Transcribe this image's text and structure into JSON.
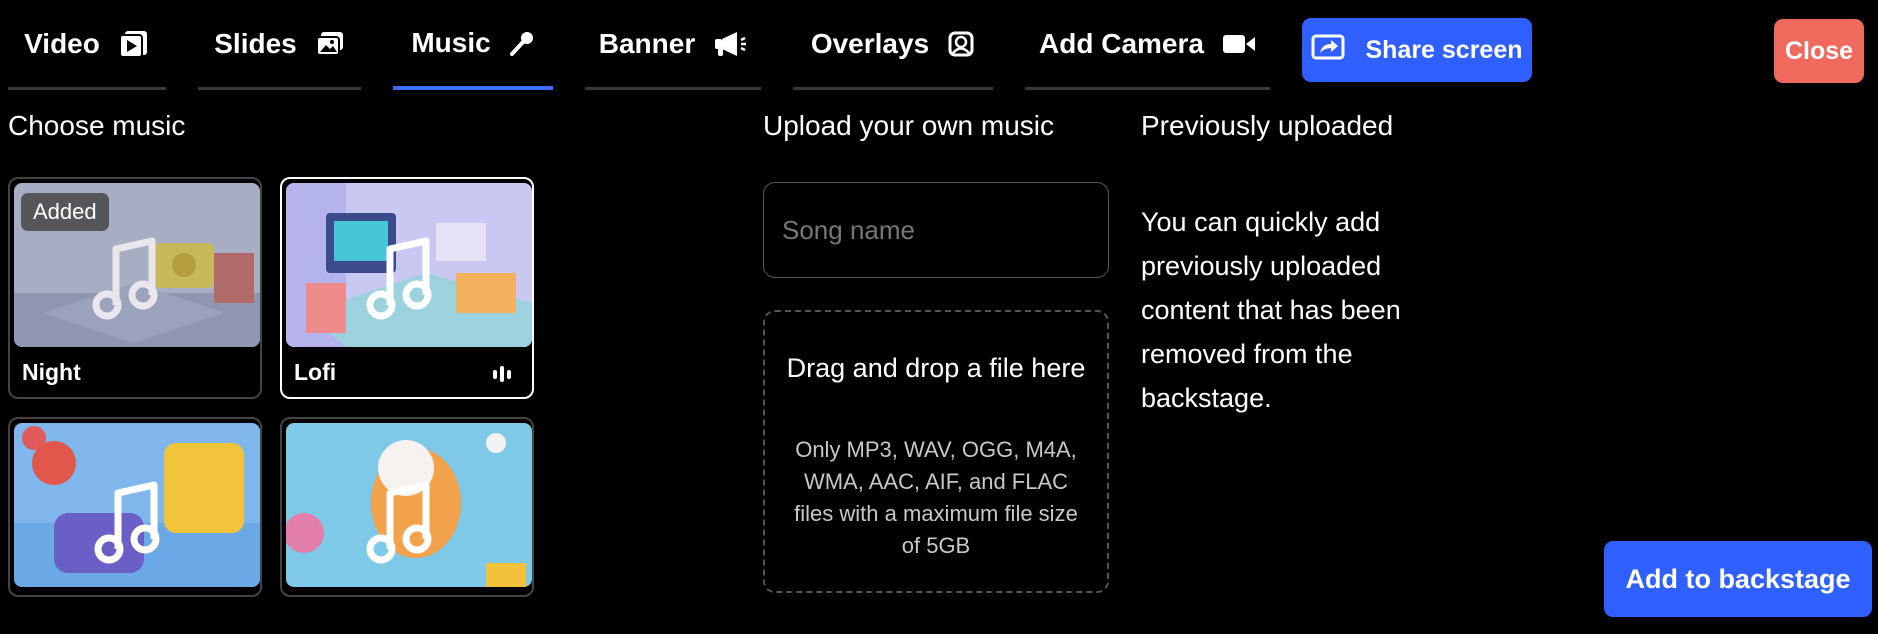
{
  "tabs": [
    {
      "label": "Video",
      "icon": "video-file-icon",
      "active": false
    },
    {
      "label": "Slides",
      "icon": "slides-icon",
      "active": false
    },
    {
      "label": "Music",
      "icon": "microphone-icon",
      "active": true
    },
    {
      "label": "Banner",
      "icon": "megaphone-icon",
      "active": false
    },
    {
      "label": "Overlays",
      "icon": "overlay-image-icon",
      "active": false
    },
    {
      "label": "Add Camera",
      "icon": "camera-icon",
      "active": false
    }
  ],
  "header": {
    "share_label": "Share screen",
    "close_label": "Close"
  },
  "colors": {
    "accent": "#2f5fff",
    "close": "#f0695d",
    "active_tab_underline": "#3d6dff"
  },
  "choose_music": {
    "heading": "Choose music",
    "tracks": [
      {
        "name": "Night",
        "badge": "Added",
        "selected": false
      },
      {
        "name": "Lofi",
        "selected": true,
        "playing": true
      },
      {
        "name": ""
      },
      {
        "name": ""
      }
    ]
  },
  "upload": {
    "heading": "Upload your own music",
    "song_name_placeholder": "Song name",
    "drop_title": "Drag and drop a file here",
    "drop_desc": "Only MP3, WAV, OGG, M4A, WMA, AAC, AIF, and FLAC files with a maximum file size of 5GB"
  },
  "previously": {
    "heading": "Previously uploaded",
    "text": "You can quickly add previously uploaded content that has been removed from the backstage."
  },
  "footer": {
    "add_label": "Add to backstage"
  }
}
